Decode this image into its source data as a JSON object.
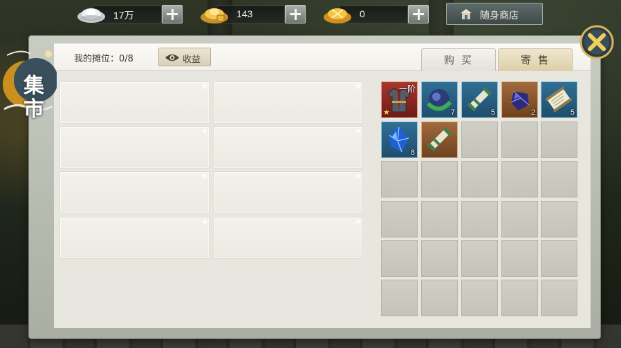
{
  "currencies": [
    {
      "icon": "silver-ingot-icon",
      "value": "17万"
    },
    {
      "icon": "gold-ingot-icon",
      "value": "143"
    },
    {
      "icon": "bound-gold-ingot-icon",
      "value": "0"
    }
  ],
  "shop_button": {
    "label": "随身商店",
    "icon": "shop-icon"
  },
  "window": {
    "title_line1": "集",
    "title_line2": "市"
  },
  "stall": {
    "label": "我的摊位：0/8",
    "slots_used": 0,
    "slots_total": 8
  },
  "income_button": {
    "label": "收益",
    "icon": "eye-icon"
  },
  "tabs": [
    {
      "label": "购买",
      "active": false
    },
    {
      "label": "寄售",
      "active": true
    }
  ],
  "inventory": {
    "columns": 5,
    "rows": 6,
    "items": [
      {
        "name": "robe-armor",
        "icon": "robe-icon",
        "rarity": "red",
        "tier": "一阶",
        "starred": true,
        "count": ""
      },
      {
        "name": "jade-orb",
        "icon": "jade-orb-icon",
        "rarity": "blue",
        "count": "7"
      },
      {
        "name": "scroll",
        "icon": "scroll-icon",
        "rarity": "blue",
        "count": "5"
      },
      {
        "name": "purple-gem",
        "icon": "purple-gem-icon",
        "rarity": "orange",
        "count": "2"
      },
      {
        "name": "paper-scroll",
        "icon": "paper-scroll-icon",
        "rarity": "blue",
        "count": "5"
      },
      {
        "name": "blue-crystal",
        "icon": "blue-crystal-icon",
        "rarity": "blue",
        "count": "8"
      },
      {
        "name": "scroll",
        "icon": "scroll-icon",
        "rarity": "orange",
        "count": ""
      }
    ]
  },
  "colors": {
    "panel_background": "#e7e6df",
    "active_tab": "#dccfa8",
    "rarity_blue": "#2f6f95",
    "rarity_orange": "#a06a3c",
    "rarity_red": "#a8362f"
  }
}
